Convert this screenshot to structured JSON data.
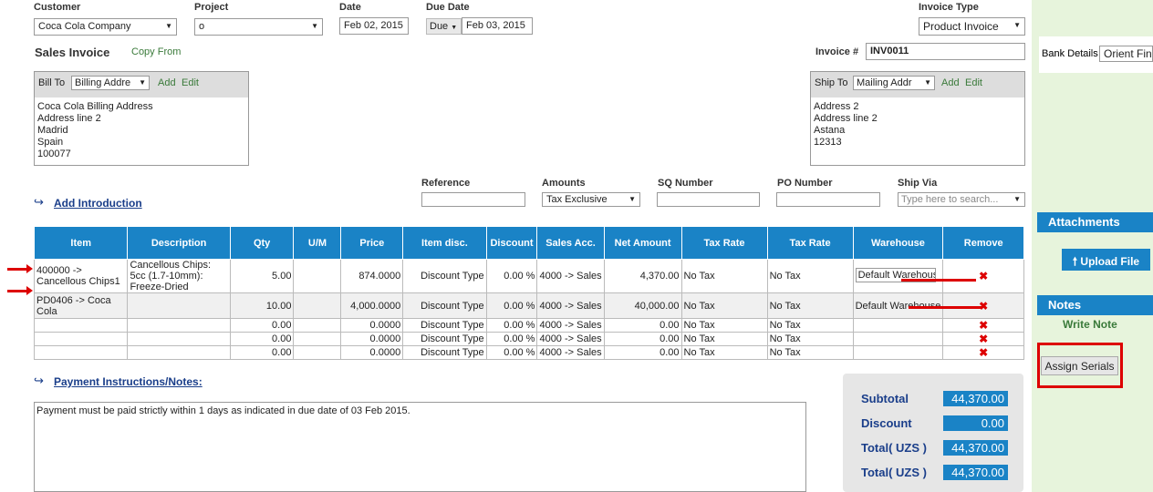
{
  "labels": {
    "customer": "Customer",
    "project": "Project",
    "date": "Date",
    "due_date": "Due Date",
    "invoice_type": "Invoice Type",
    "sales_invoice": "Sales Invoice",
    "copy_from": "Copy From",
    "invoice_no": "Invoice #",
    "bank_details": "Bank Details",
    "reference": "Reference",
    "amounts": "Amounts",
    "sq_number": "SQ Number",
    "po_number": "PO Number",
    "ship_via": "Ship Via",
    "add_introduction": "Add Introduction",
    "payment_instructions": "Payment Instructions/Notes:"
  },
  "fields": {
    "customer": "Coca Cola Company",
    "project": "o",
    "date": "Feb 02, 2015",
    "due_mode": "Due",
    "due_date": "Feb 03, 2015",
    "invoice_type": "Product Invoice",
    "invoice_no": "INV0011",
    "bank_details": "Orient Fina",
    "amounts": "Tax Exclusive",
    "ship_via_placeholder": "Type here to search...",
    "payment_notes": "Payment must be paid strictly within 1 days as indicated in due date of 03 Feb 2015."
  },
  "bill_to": {
    "label": "Bill To",
    "select": "Billing Addre",
    "add": "Add",
    "edit": "Edit",
    "lines": [
      "Coca Cola Billing Address",
      "Address line 2",
      "Madrid",
      "Spain",
      "100077"
    ]
  },
  "ship_to": {
    "label": "Ship To",
    "select": "Mailing Addr",
    "add": "Add",
    "edit": "Edit",
    "lines": [
      "Address 2",
      "Address line 2",
      "Astana",
      "12313"
    ]
  },
  "table": {
    "headers": [
      "Item",
      "Description",
      "Qty",
      "U/M",
      "Price",
      "Item disc.",
      "Discount",
      "Sales Acc.",
      "Net Amount",
      "Tax Rate",
      "Tax Rate",
      "Warehouse",
      "Remove"
    ],
    "rows": [
      {
        "item": "400000 -> Cancellous Chips1",
        "desc": "Cancellous Chips: 5cc (1.7-10mm): Freeze-Dried",
        "qty": "5.00",
        "um": "",
        "price": "874.0000",
        "disc_type": "Discount Type",
        "disc": "0.00 %",
        "acc": "4000 -> Sales",
        "net": "4,370.00",
        "tax1": "No Tax",
        "tax2": "No Tax",
        "wh": "Default Warehouse",
        "remove": "✖"
      },
      {
        "item": "PD0406 -> Coca Cola",
        "desc": "",
        "qty": "10.00",
        "um": "",
        "price": "4,000.0000",
        "disc_type": "Discount Type",
        "disc": "0.00 %",
        "acc": "4000 -> Sales",
        "net": "40,000.00",
        "tax1": "No Tax",
        "tax2": "No Tax",
        "wh": "Default Warehouse",
        "remove": "✖"
      },
      {
        "item": "",
        "desc": "",
        "qty": "0.00",
        "um": "",
        "price": "0.0000",
        "disc_type": "Discount Type",
        "disc": "0.00 %",
        "acc": "4000 -> Sales",
        "net": "0.00",
        "tax1": "No Tax",
        "tax2": "No Tax",
        "wh": "",
        "remove": "✖"
      },
      {
        "item": "",
        "desc": "",
        "qty": "0.00",
        "um": "",
        "price": "0.0000",
        "disc_type": "Discount Type",
        "disc": "0.00 %",
        "acc": "4000 -> Sales",
        "net": "0.00",
        "tax1": "No Tax",
        "tax2": "No Tax",
        "wh": "",
        "remove": "✖"
      },
      {
        "item": "",
        "desc": "",
        "qty": "0.00",
        "um": "",
        "price": "0.0000",
        "disc_type": "Discount Type",
        "disc": "0.00 %",
        "acc": "4000 -> Sales",
        "net": "0.00",
        "tax1": "No Tax",
        "tax2": "No Tax",
        "wh": "",
        "remove": "✖"
      }
    ]
  },
  "totals": {
    "subtotal_label": "Subtotal",
    "subtotal": "44,370.00",
    "discount_label": "Discount",
    "discount": "0.00",
    "total1_label": "Total( UZS )",
    "total1": "44,370.00",
    "total2_label": "Total( UZS )",
    "total2": "44,370.00"
  },
  "sidebar": {
    "attachments": "Attachments",
    "upload": "Upload File",
    "notes": "Notes",
    "write_note": "Write Note",
    "assign_serials": "Assign Serials"
  },
  "colors": {
    "accent": "#1a83c6",
    "sidebar_bg": "#e7f4dc",
    "annotation": "#dd0000"
  }
}
